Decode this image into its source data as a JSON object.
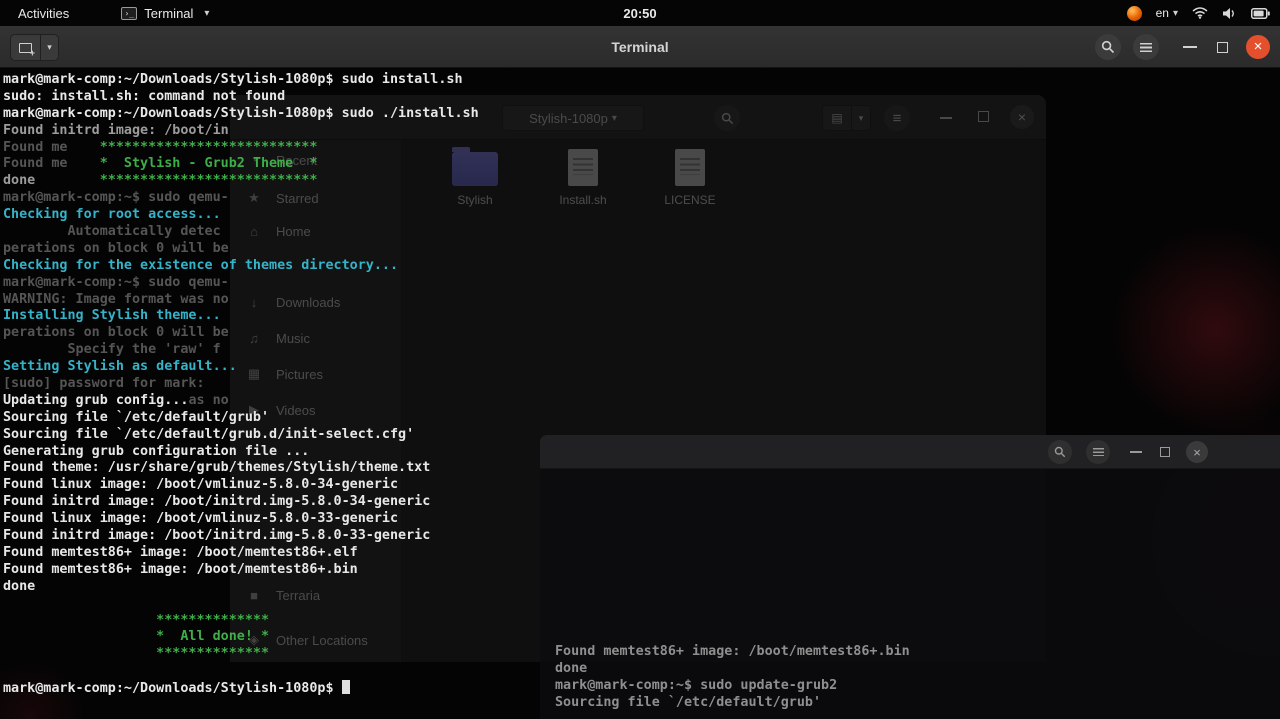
{
  "top_bar": {
    "activities_label": "Activities",
    "app_name": "Terminal",
    "clock": "20:50",
    "language_indicator": "en",
    "status_icons": [
      "firefox-icon",
      "wifi-icon",
      "volume-icon",
      "battery-icon"
    ]
  },
  "header_bar": {
    "title": "Terminal"
  },
  "colors": {
    "close_button": "#e4502e",
    "terminal_green": "#3fae49",
    "terminal_cyan": "#35b3c9",
    "terminal_foreground": "#e8e8e8",
    "folder_icon": "#8a86f2"
  },
  "terminal": {
    "lines": [
      {
        "segs": [
          [
            "fg",
            "mark@mark-comp:~/Downloads/Stylish-1080p$ sudo install.sh"
          ]
        ]
      },
      {
        "segs": [
          [
            "fg",
            "sudo: install.sh: command not found"
          ]
        ]
      },
      {
        "segs": [
          [
            "fg",
            "mark@mark-comp:~/Downloads/Stylish-1080p$ sudo ./install.sh"
          ]
        ]
      },
      {
        "segs": [
          [
            "dim2",
            "Found initrd image: /boot/in"
          ]
        ]
      },
      {
        "segs": [
          [
            "dim",
            "Found me"
          ],
          [
            "green",
            "    ***************************"
          ]
        ]
      },
      {
        "segs": [
          [
            "dim",
            "Found me"
          ],
          [
            "green",
            "    *  Stylish - Grub2 Theme  *"
          ]
        ]
      },
      {
        "segs": [
          [
            "dim2",
            "done"
          ],
          [
            "green",
            "        ***************************"
          ]
        ]
      },
      {
        "segs": [
          [
            "dim",
            "mark@mark-comp:~$ sudo qemu-"
          ]
        ]
      },
      {
        "segs": [
          [
            "cyan",
            "Checking for root access..."
          ]
        ]
      },
      {
        "segs": [
          [
            "dim",
            "        Automatically detec"
          ]
        ]
      },
      {
        "segs": [
          [
            "dim",
            "perations on block 0 will be"
          ]
        ]
      },
      {
        "segs": [
          [
            "cyan",
            "Checking for the existence of themes directory..."
          ]
        ]
      },
      {
        "segs": [
          [
            "dim",
            "mark@mark-comp:~$ sudo qemu-"
          ]
        ]
      },
      {
        "segs": [
          [
            "dim",
            "WARNING: Image format was no"
          ]
        ]
      },
      {
        "segs": [
          [
            "cyan",
            "Installing Stylish theme..."
          ]
        ]
      },
      {
        "segs": [
          [
            "dim",
            "perations on block 0 will be"
          ]
        ]
      },
      {
        "segs": [
          [
            "dim",
            "        Specify the 'raw' f"
          ]
        ]
      },
      {
        "segs": [
          [
            "cyan",
            "Setting Stylish as default..."
          ]
        ]
      },
      {
        "segs": [
          [
            "dim",
            "[sudo] password for mark:"
          ]
        ]
      },
      {
        "segs": [
          [
            "fg",
            "Updating grub config..."
          ],
          [
            "dim",
            "as no"
          ]
        ]
      },
      {
        "segs": [
          [
            "fg",
            "Sourcing file `/etc/default/grub'"
          ]
        ]
      },
      {
        "segs": [
          [
            "fg",
            "Sourcing file `/etc/default/grub.d/init-select.cfg'"
          ]
        ]
      },
      {
        "segs": [
          [
            "fg",
            "Generating grub configuration file ..."
          ]
        ]
      },
      {
        "segs": [
          [
            "fg",
            "Found theme: /usr/share/grub/themes/Stylish/theme.txt"
          ]
        ]
      },
      {
        "segs": [
          [
            "fg",
            "Found linux image: /boot/vmlinuz-5.8.0-34-generic"
          ]
        ]
      },
      {
        "segs": [
          [
            "fg",
            "Found initrd image: /boot/initrd.img-5.8.0-34-generic"
          ]
        ]
      },
      {
        "segs": [
          [
            "fg",
            "Found linux image: /boot/vmlinuz-5.8.0-33-generic"
          ]
        ]
      },
      {
        "segs": [
          [
            "fg",
            "Found initrd image: /boot/initrd.img-5.8.0-33-generic"
          ]
        ]
      },
      {
        "segs": [
          [
            "fg",
            "Found memtest86+ image: /boot/memtest86+.elf"
          ]
        ]
      },
      {
        "segs": [
          [
            "fg",
            "Found memtest86+ image: /boot/memtest86+.bin"
          ]
        ]
      },
      {
        "segs": [
          [
            "fg",
            "done"
          ]
        ]
      },
      {
        "segs": []
      },
      {
        "segs": [
          [
            "green",
            "                   **************"
          ]
        ]
      },
      {
        "segs": [
          [
            "green",
            "                   *  All done! *"
          ]
        ]
      },
      {
        "segs": [
          [
            "green",
            "                   **************"
          ]
        ]
      },
      {
        "segs": []
      },
      {
        "segs": [
          [
            "fg",
            "mark@mark-comp:~/Downloads/Stylish-1080p$ "
          ]
        ],
        "cursor": true
      }
    ]
  },
  "files_window": {
    "path_button": "Stylish-1080p",
    "sidebar": [
      {
        "id": "recent",
        "label": "Recent",
        "glyph": "◔"
      },
      {
        "id": "starred",
        "label": "Starred",
        "glyph": "★"
      },
      {
        "id": "home",
        "label": "Home",
        "glyph": "⌂"
      },
      {
        "id": "downloads",
        "label": "Downloads",
        "glyph": "↓"
      },
      {
        "id": "music",
        "label": "Music",
        "glyph": "♫"
      },
      {
        "id": "pictures",
        "label": "Pictures",
        "glyph": "▦"
      },
      {
        "id": "videos",
        "label": "Videos",
        "glyph": "▶"
      },
      {
        "id": "terraria",
        "label": "Terraria",
        "glyph": "■"
      },
      {
        "id": "other-locations",
        "label": "Other Locations",
        "glyph": "◈"
      }
    ],
    "files": [
      {
        "label": "Stylish",
        "type": "folder"
      },
      {
        "label": "Install.sh",
        "type": "file"
      },
      {
        "label": "LICENSE",
        "type": "file"
      }
    ]
  },
  "background_terminal": {
    "lines": [
      "Found memtest86+ image: /boot/memtest86+.bin",
      "done",
      "mark@mark-comp:~$ sudo update-grub2",
      "Sourcing file `/etc/default/grub'"
    ]
  }
}
